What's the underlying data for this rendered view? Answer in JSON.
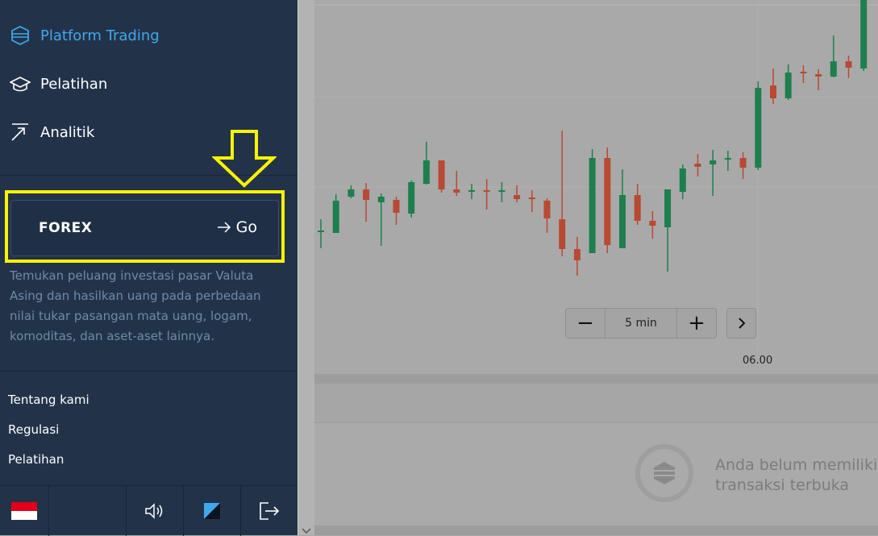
{
  "nav": {
    "items": [
      {
        "label": "Platform Trading",
        "icon": "platform-icon",
        "active": true
      },
      {
        "label": "Pelatihan",
        "icon": "graduation-cap-icon"
      },
      {
        "label": "Analitik",
        "icon": "analytics-arrow-icon"
      }
    ]
  },
  "forex": {
    "title": "FOREX",
    "go_label": "Go",
    "description": "Temukan peluang investasi pasar Valuta Asing dan hasilkan uang pada perbedaan nilai tukar pasangan mata uang, logam, komoditas, dan aset-aset lainnya."
  },
  "footer": {
    "links": [
      "Tentang kami",
      "Regulasi",
      "Pelatihan"
    ]
  },
  "bottom_bar": {
    "icons": [
      "indonesia-flag-icon",
      "volume-icon",
      "theme-icon",
      "logout-icon"
    ]
  },
  "chart": {
    "zoom_minus": "−",
    "zoom_value": "5 min",
    "zoom_plus": "+",
    "time_label": "06.00",
    "colors": {
      "up": "#1e7f4e",
      "down": "#b84a32",
      "highlight": "#fff200",
      "accent": "#3fa7ec"
    }
  },
  "chart_data": {
    "type": "candlestick",
    "candles": [
      {
        "dir": "up",
        "o": 286,
        "c": 286,
        "h": 272,
        "l": 308
      },
      {
        "dir": "up",
        "o": 289,
        "c": 249,
        "h": 241,
        "l": 289
      },
      {
        "dir": "up",
        "o": 244,
        "c": 235,
        "h": 230,
        "l": 246
      },
      {
        "dir": "down",
        "o": 235,
        "c": 248,
        "h": 227,
        "l": 275
      },
      {
        "dir": "up",
        "o": 251,
        "c": 244,
        "h": 240,
        "l": 305
      },
      {
        "dir": "down",
        "o": 248,
        "c": 264,
        "h": 244,
        "l": 279
      },
      {
        "dir": "up",
        "o": 265,
        "c": 226,
        "h": 224,
        "l": 270
      },
      {
        "dir": "up",
        "o": 228,
        "c": 199,
        "h": 176,
        "l": 229
      },
      {
        "dir": "down",
        "o": 199,
        "c": 235,
        "h": 199,
        "l": 239
      },
      {
        "dir": "down",
        "o": 235,
        "c": 239,
        "h": 212,
        "l": 243
      },
      {
        "dir": "up",
        "o": 238,
        "c": 236,
        "h": 228,
        "l": 247
      },
      {
        "dir": "down",
        "o": 236,
        "c": 238,
        "h": 222,
        "l": 260
      },
      {
        "dir": "up",
        "o": 238,
        "c": 236,
        "h": 226,
        "l": 251
      },
      {
        "dir": "down",
        "o": 242,
        "c": 247,
        "h": 230,
        "l": 251
      },
      {
        "dir": "down",
        "o": 245,
        "c": 247,
        "h": 236,
        "l": 263
      },
      {
        "dir": "down",
        "o": 249,
        "c": 271,
        "h": 246,
        "l": 289
      },
      {
        "dir": "down",
        "o": 272,
        "c": 309,
        "h": 162,
        "l": 318
      },
      {
        "dir": "down",
        "o": 309,
        "c": 323,
        "h": 294,
        "l": 342
      },
      {
        "dir": "up",
        "o": 314,
        "c": 196,
        "h": 185,
        "l": 314
      },
      {
        "dir": "down",
        "o": 196,
        "c": 304,
        "h": 183,
        "l": 314
      },
      {
        "dir": "up",
        "o": 308,
        "c": 242,
        "h": 210,
        "l": 308
      },
      {
        "dir": "down",
        "o": 242,
        "c": 274,
        "h": 228,
        "l": 279
      },
      {
        "dir": "down",
        "o": 274,
        "c": 280,
        "h": 262,
        "l": 296
      },
      {
        "dir": "up",
        "o": 282,
        "c": 235,
        "h": 235,
        "l": 337
      },
      {
        "dir": "up",
        "o": 238,
        "c": 209,
        "h": 204,
        "l": 247
      },
      {
        "dir": "down",
        "o": 203,
        "c": 207,
        "h": 191,
        "l": 219
      },
      {
        "dir": "up",
        "o": 204,
        "c": 199,
        "h": 186,
        "l": 243
      },
      {
        "dir": "up",
        "o": 198,
        "c": 196,
        "h": 187,
        "l": 212
      },
      {
        "dir": "down",
        "o": 196,
        "c": 208,
        "h": 189,
        "l": 222
      },
      {
        "dir": "up",
        "o": 208,
        "c": 109,
        "h": 101,
        "l": 211
      },
      {
        "dir": "down",
        "o": 106,
        "c": 122,
        "h": 85,
        "l": 129
      },
      {
        "dir": "up",
        "o": 122,
        "c": 90,
        "h": 80,
        "l": 124
      },
      {
        "dir": "down",
        "o": 89,
        "c": 91,
        "h": 81,
        "l": 103
      },
      {
        "dir": "down",
        "o": 92,
        "c": 95,
        "h": 86,
        "l": 112
      },
      {
        "dir": "up",
        "o": 95,
        "c": 76,
        "h": 44,
        "l": 96
      },
      {
        "dir": "down",
        "o": 76,
        "c": 84,
        "h": 69,
        "l": 97
      },
      {
        "dir": "up",
        "o": 85,
        "c": 0,
        "h": 0,
        "l": 88
      }
    ]
  },
  "empty_state": {
    "text": "Anda belum memiliki\ntransaksi terbuka",
    "icon": "empty-trades-icon"
  }
}
